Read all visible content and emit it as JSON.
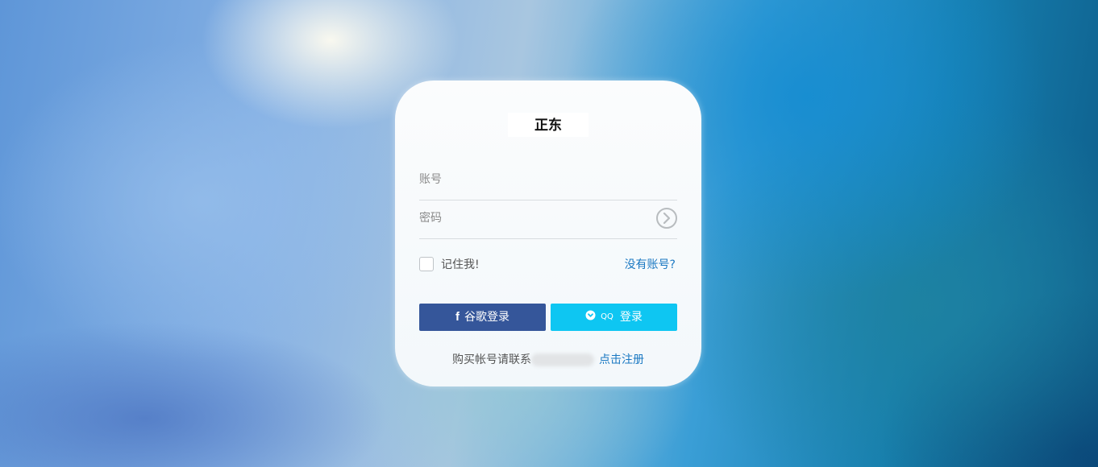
{
  "brand": {
    "title": "正东"
  },
  "login_form": {
    "account_placeholder": "账号",
    "password_placeholder": "密码",
    "remember_label": "记住我!",
    "no_account_link": "没有账号?",
    "google_login_label": "谷歌登录",
    "qq_icon_text": "QQ",
    "qq_login_label": "登录",
    "footer_text": "购买帐号请联系",
    "register_link": "点击注册"
  },
  "colors": {
    "google_button": "#35569a",
    "qq_button": "#0ec6f2",
    "link": "#1a78c2"
  },
  "icons": {
    "submit": "chevron-right-circle-icon",
    "google": "facebook-f-icon",
    "qq": "chat-bubble-icon"
  }
}
